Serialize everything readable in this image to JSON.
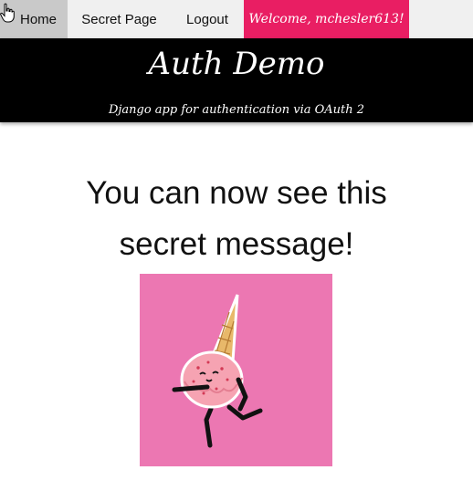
{
  "nav": {
    "home": "Home",
    "secret": "Secret Page",
    "logout": "Logout",
    "welcome": "Welcome, mchesler613!"
  },
  "header": {
    "title": "Auth Demo",
    "subtitle": "Django app for authentication via OAuth 2"
  },
  "main": {
    "message_line1": "You can now see this",
    "message_line2": "secret message!"
  },
  "colors": {
    "accent": "#e91e63",
    "header_bg": "#000000",
    "nav_bg": "#f0f0f0",
    "illustration_bg": "#ec77b2"
  },
  "icons": {
    "cursor": "hand-pointer-icon",
    "illustration": "ice-cream-cone-character"
  }
}
